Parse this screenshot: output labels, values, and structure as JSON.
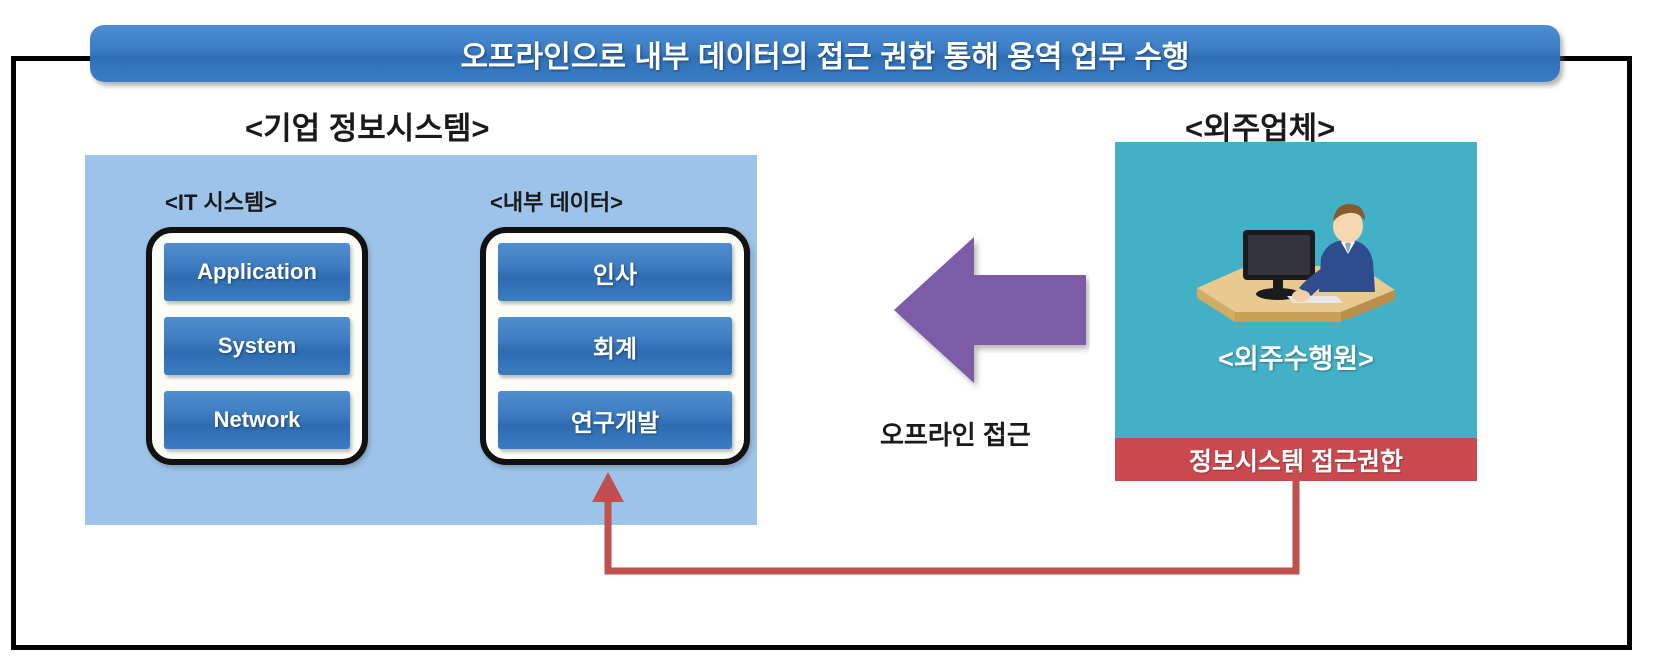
{
  "banner": {
    "text": "오프라인으로 내부 데이터의 접근 권한 통해 용역 업무 수행"
  },
  "enterprise": {
    "caption": "<기업 정보시스템>",
    "it_system": {
      "caption": "<IT 시스템>",
      "items": [
        {
          "label": "Application"
        },
        {
          "label": "System"
        },
        {
          "label": "Network"
        }
      ]
    },
    "internal_data": {
      "caption": "<내부 데이터>",
      "items": [
        {
          "label": "인사"
        },
        {
          "label": "회계"
        },
        {
          "label": "연구개발"
        }
      ]
    }
  },
  "vendor": {
    "caption": "<외주업체>",
    "worker_label": "<외주수행원>",
    "privilege_label": "정보시스템 접근권한",
    "illustration": "person-at-desk-icon"
  },
  "flow": {
    "arrow_label": "오프라인 접근",
    "arrow_icon": "left-arrow-icon",
    "connector_icon": "up-arrow-connector-icon"
  },
  "colors": {
    "banner_blue": "#3b7dc4",
    "panel_light_blue": "#9dc3ea",
    "chip_blue": "#3d7cc0",
    "vendor_teal": "#42b0c6",
    "privilege_red": "#c9494f",
    "arrow_purple": "#7c5ba6",
    "connector_red": "#c0504d",
    "frame_black": "#000000"
  }
}
